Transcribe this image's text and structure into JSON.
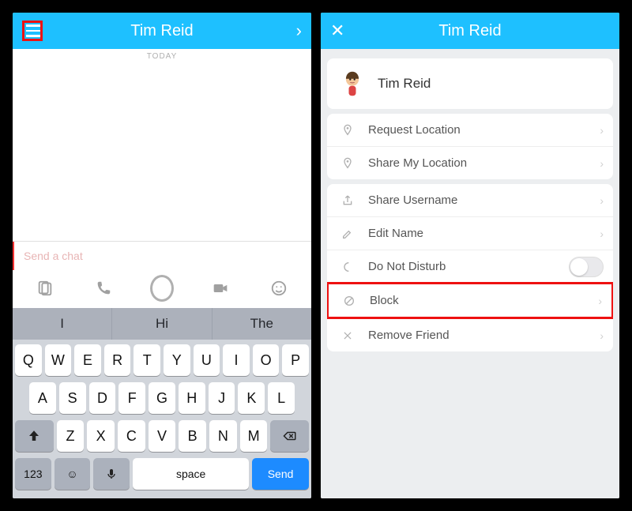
{
  "colors": {
    "accent": "#1ec0ff",
    "highlight": "#e11",
    "send": "#1d8bff"
  },
  "left": {
    "header": {
      "menu_icon": "menu-icon",
      "title": "Tim Reid",
      "right_icon": "chevron-right"
    },
    "chat": {
      "date_label": "TODAY",
      "input_placeholder": "Send a chat"
    },
    "action_icons": [
      "sticker-icon",
      "phone-icon",
      "shutter-icon",
      "video-icon",
      "smiley-icon"
    ],
    "suggestions": [
      "I",
      "Hi",
      "The"
    ],
    "keyboard": {
      "row1": [
        "Q",
        "W",
        "E",
        "R",
        "T",
        "Y",
        "U",
        "I",
        "O",
        "P"
      ],
      "row2": [
        "A",
        "S",
        "D",
        "F",
        "G",
        "H",
        "J",
        "K",
        "L"
      ],
      "row3": [
        "Z",
        "X",
        "C",
        "V",
        "B",
        "N",
        "M"
      ],
      "shift": "⇧",
      "backspace": "⌫",
      "numkey": "123",
      "emoji": "☺",
      "mic": "🎤",
      "space": "space",
      "send": "Send"
    }
  },
  "right": {
    "header": {
      "close_icon": "close-x",
      "title": "Tim Reid"
    },
    "profile": {
      "name": "Tim Reid",
      "avatar": "bitmoji-avatar"
    },
    "items": [
      {
        "icon": "location-pin-icon",
        "label": "Request Location",
        "type": "chev"
      },
      {
        "icon": "location-pin-icon",
        "label": "Share My Location",
        "type": "chev"
      },
      {
        "icon": "share-icon",
        "label": "Share Username",
        "type": "chev"
      },
      {
        "icon": "pencil-icon",
        "label": "Edit Name",
        "type": "chev"
      },
      {
        "icon": "moon-icon",
        "label": "Do Not Disturb",
        "type": "toggle"
      },
      {
        "icon": "block-icon",
        "label": "Block",
        "type": "chev",
        "highlighted": true
      },
      {
        "icon": "x-icon",
        "label": "Remove Friend",
        "type": "chev"
      }
    ]
  }
}
